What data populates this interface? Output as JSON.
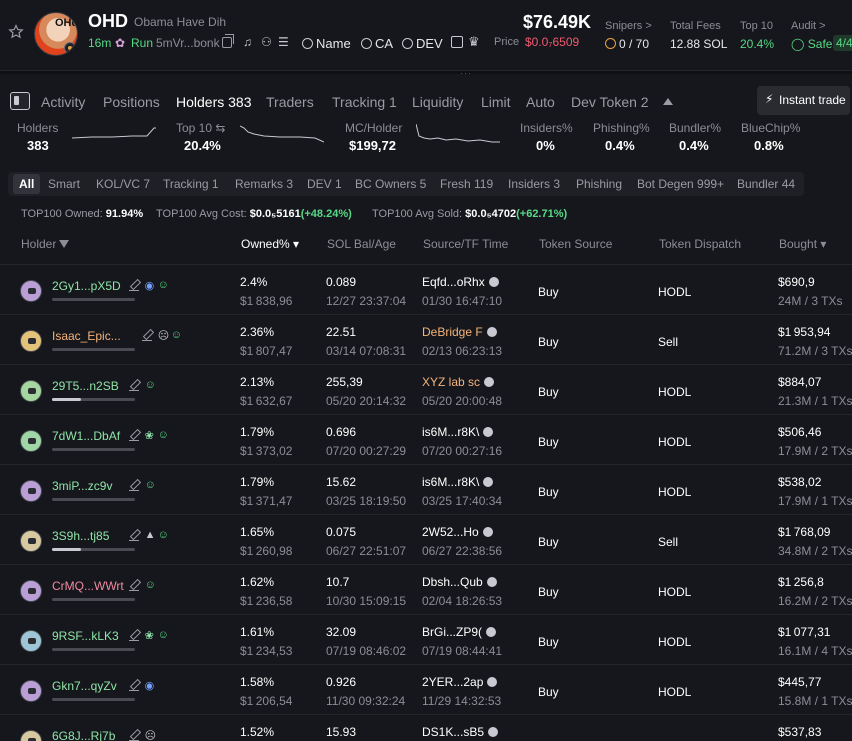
{
  "token": {
    "ticker": "OHD",
    "name": "Obama Have Dih",
    "avatar_text": "OHd",
    "age": "16m",
    "run_label": "Run",
    "address": "5mVr...bonk",
    "search_links": [
      "Name",
      "CA",
      "DEV"
    ],
    "price_usd": "$76.49K",
    "price_label": "Price",
    "price_sol": "$0.0₇6509"
  },
  "stats": [
    {
      "label": "Snipers >",
      "value": "0 / 70"
    },
    {
      "label": "Total Fees",
      "value": "12.88 SOL"
    },
    {
      "label": "Top 10",
      "value": "20.4%"
    },
    {
      "label": "Audit >",
      "value": "Safe",
      "badge": "4/4"
    }
  ],
  "tabs": [
    {
      "label": "Activity"
    },
    {
      "label": "Positions"
    },
    {
      "label": "Holders 383",
      "active": true
    },
    {
      "label": "Traders"
    },
    {
      "label": "Tracking 1"
    },
    {
      "label": "Liquidity"
    },
    {
      "label": "Limit"
    },
    {
      "label": "Auto"
    },
    {
      "label": "Dev Token 2"
    }
  ],
  "instant_trade_label": "Instant trade",
  "metrics": [
    {
      "label": "Holders",
      "value": "383"
    },
    {
      "label": "Top 10 ⇆",
      "value": "20.4%"
    },
    {
      "label": "MC/Holder",
      "value": "$199,72"
    },
    {
      "label": "Insiders%",
      "value": "0%"
    },
    {
      "label": "Phishing%",
      "value": "0.4%"
    },
    {
      "label": "Bundler%",
      "value": "0.4%"
    },
    {
      "label": "BlueChip%",
      "value": "0.8%"
    }
  ],
  "filters": [
    "All",
    "Smart",
    "KOL/VC 7",
    "Tracking 1",
    "Remarks 3",
    "DEV 1",
    "BC Owners 5",
    "Fresh 119",
    "Insiders 3",
    "Phishing",
    "Bot Degen 999+",
    "Bundler 44"
  ],
  "summary": {
    "owned_label": "TOP100 Owned:",
    "owned_value": "91.94%",
    "cost_label": "TOP100 Avg Cost:",
    "cost_value": "$0.0₅5161",
    "cost_change": "(+48.24%)",
    "sold_label": "TOP100 Avg Sold:",
    "sold_value": "$0.0₅4702",
    "sold_change": "(+62.71%)"
  },
  "columns": [
    "Holder",
    "Owned% ▾",
    "SOL Bal/Age",
    "Source/TF Time",
    "Token Source",
    "Token Dispatch",
    "Bought ▾"
  ],
  "rows": [
    {
      "name": "2Gy1...pX5D",
      "color": "#8fe3a8",
      "icons": [
        "◉",
        "☺"
      ],
      "bar": 0.0,
      "owned": "2.4%",
      "owned_usd": "$1 838,96",
      "sol": "0.089",
      "age": "12/27 23:37:04",
      "src": "Eqfd...oRhx",
      "src_color": "#ffffff",
      "src_time": "01/30 16:47:10",
      "token_source": "Buy",
      "dispatch": "HODL",
      "bought": "$690,9",
      "bought_sub": "24M / 3 TXs",
      "pfp": "#b99fd6"
    },
    {
      "name": "Isaac_Epic...",
      "color": "#f3b37a",
      "icons": [
        "☹",
        "☺"
      ],
      "bar": 0.0,
      "owned": "2.36%",
      "owned_usd": "$1 807,47",
      "sol": "22.51",
      "age": "03/14 07:08:31",
      "src": "DeBridge F",
      "src_color": "#f3b37a",
      "src_time": "02/13 06:23:13",
      "token_source": "Buy",
      "dispatch": "Sell",
      "bought": "$1 953,94",
      "bought_sub": "71.2M / 3 TXs",
      "pfp": "#e3c27a"
    },
    {
      "name": "29T5...n2SB",
      "color": "#8fe3a8",
      "icons": [
        "☺"
      ],
      "bar": 0.35,
      "owned": "2.13%",
      "owned_usd": "$1 632,67",
      "sol": "255,39",
      "age": "05/20 20:14:32",
      "src": "XYZ lab sc",
      "src_color": "#f3b37a",
      "src_time": "05/20 20:00:48",
      "token_source": "Buy",
      "dispatch": "HODL",
      "bought": "$884,07",
      "bought_sub": "21.3M / 1 TXs",
      "pfp": "#a6d6a0"
    },
    {
      "name": "7dW1...DbAf",
      "color": "#8fe3a8",
      "icons": [
        "❀",
        "☺"
      ],
      "bar": 0.0,
      "owned": "1.79%",
      "owned_usd": "$1 373,02",
      "sol": "0.696",
      "age": "07/20 00:27:29",
      "src": "is6M...r8K\\",
      "src_color": "#ffffff",
      "src_time": "07/20 00:27:16",
      "token_source": "Buy",
      "dispatch": "HODL",
      "bought": "$506,46",
      "bought_sub": "17.9M / 2 TXs",
      "pfp": "#9fd6a6"
    },
    {
      "name": "3miP...zc9v",
      "color": "#8fe3a8",
      "icons": [
        "☺"
      ],
      "bar": 0.0,
      "owned": "1.79%",
      "owned_usd": "$1 371,47",
      "sol": "15.62",
      "age": "03/25 18:19:50",
      "src": "is6M...r8K\\",
      "src_color": "#ffffff",
      "src_time": "03/25 17:40:34",
      "token_source": "Buy",
      "dispatch": "HODL",
      "bought": "$538,02",
      "bought_sub": "17.9M / 1 TXs",
      "pfp": "#b99fd6"
    },
    {
      "name": "3S9h...tj85",
      "color": "#8fe3a8",
      "icons": [
        "▲",
        "☺"
      ],
      "bar": 0.35,
      "owned": "1.65%",
      "owned_usd": "$1 260,98",
      "sol": "0.075",
      "age": "06/27 22:51:07",
      "src": "2W52...Ho",
      "src_color": "#ffffff",
      "src_time": "06/27 22:38:56",
      "token_source": "Buy",
      "dispatch": "Sell",
      "bought": "$1 768,09",
      "bought_sub": "34.8M / 2 TXs",
      "pfp": "#d6c89f"
    },
    {
      "name": "CrMQ...WWrt",
      "color": "#f08aa0",
      "icons": [
        "☺"
      ],
      "bar": 0.0,
      "owned": "1.62%",
      "owned_usd": "$1 236,58",
      "sol": "10.7",
      "age": "10/30 15:09:15",
      "src": "Dbsh...Qub",
      "src_color": "#ffffff",
      "src_time": "02/04 18:26:53",
      "token_source": "Buy",
      "dispatch": "HODL",
      "bought": "$1 256,8",
      "bought_sub": "16.2M / 2 TXs",
      "pfp": "#b99fd6"
    },
    {
      "name": "9RSF...kLK3",
      "color": "#8fe3a8",
      "icons": [
        "❀",
        "☺"
      ],
      "bar": 0.0,
      "owned": "1.61%",
      "owned_usd": "$1 234,53",
      "sol": "32.09",
      "age": "07/19 08:46:02",
      "src": "BrGi...ZP9(",
      "src_color": "#ffffff",
      "src_time": "07/19 08:44:41",
      "token_source": "Buy",
      "dispatch": "HODL",
      "bought": "$1 077,31",
      "bought_sub": "16.1M / 4 TXs",
      "pfp": "#9fc6d6"
    },
    {
      "name": "Gkn7...qyZv",
      "color": "#8fe3a8",
      "icons": [
        "◉"
      ],
      "bar": 0.0,
      "owned": "1.58%",
      "owned_usd": "$1 206,54",
      "sol": "0.926",
      "age": "11/30 09:32:24",
      "src": "2YER...2ap",
      "src_color": "#ffffff",
      "src_time": "11/29 14:32:53",
      "token_source": "Buy",
      "dispatch": "HODL",
      "bought": "$445,77",
      "bought_sub": "15.8M / 1 TXs",
      "pfp": "#b99fd6"
    },
    {
      "name": "6G8J...Rj7b",
      "color": "#8fe3a8",
      "icons": [
        "☹"
      ],
      "bar": 0.0,
      "owned": "1.52%",
      "owned_usd": "",
      "sol": "15.93",
      "age": "",
      "src": "DS1K...sB5",
      "src_color": "#ffffff",
      "src_time": "",
      "token_source": "",
      "dispatch": "",
      "bought": "$537,83",
      "bought_sub": "",
      "pfp": "#d6c89f"
    }
  ]
}
